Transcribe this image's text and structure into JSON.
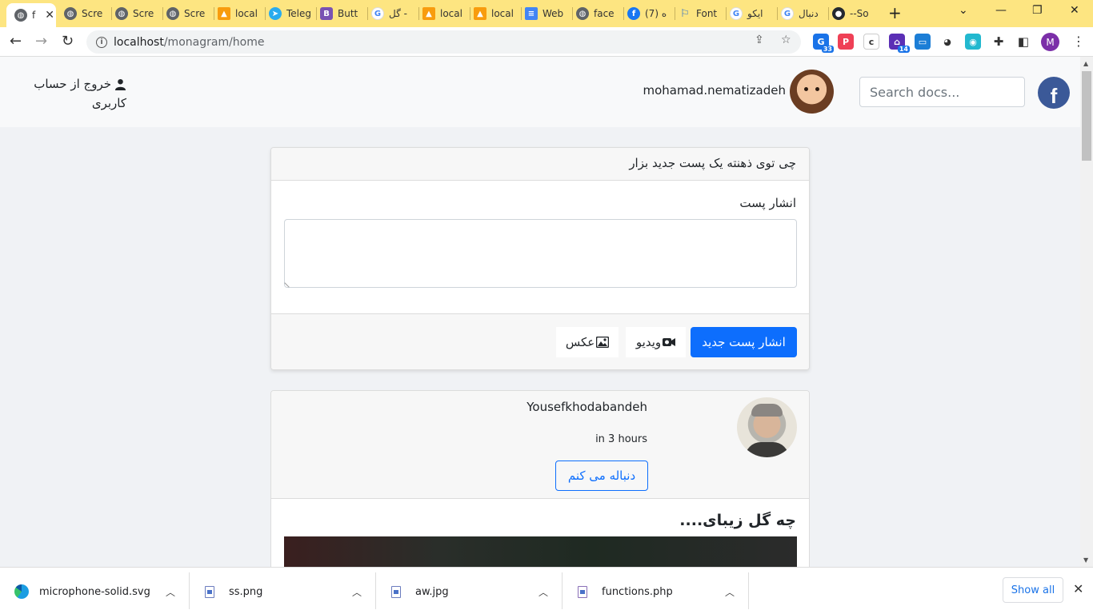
{
  "browser": {
    "tabs": [
      {
        "title": "f",
        "icon": "globe-icon",
        "active": true
      },
      {
        "title": "Scre",
        "icon": "globe-icon"
      },
      {
        "title": "Scre",
        "icon": "globe-icon"
      },
      {
        "title": "Scre",
        "icon": "globe-icon"
      },
      {
        "title": "local",
        "icon": "phpmyadmin-icon"
      },
      {
        "title": "Teleg",
        "icon": "telegram-icon"
      },
      {
        "title": "Butt",
        "icon": "bootstrap-icon"
      },
      {
        "title": "گل -",
        "icon": "google-icon"
      },
      {
        "title": "local",
        "icon": "phpmyadmin-icon"
      },
      {
        "title": "local",
        "icon": "phpmyadmin-icon"
      },
      {
        "title": "Web",
        "icon": "docs-icon"
      },
      {
        "title": "face",
        "icon": "globe-icon"
      },
      {
        "title": "(7) ه",
        "icon": "facebook-icon"
      },
      {
        "title": "Font",
        "icon": "flag-icon"
      },
      {
        "title": "ایکو",
        "icon": "google-icon"
      },
      {
        "title": "دنبال",
        "icon": "google-icon"
      },
      {
        "title": "--So",
        "icon": "github-icon"
      }
    ],
    "new_tab": "+",
    "url_host": "localhost",
    "url_path": "/monagram/home",
    "extensions": [
      {
        "icon": "translate-icon",
        "badge": "33",
        "color": "#1a73e8"
      },
      {
        "icon": "pocket-icon",
        "badge": "",
        "color": "#ef4056"
      },
      {
        "icon": "c-icon",
        "badge": "",
        "color": "#ffffff"
      },
      {
        "icon": "school-icon",
        "badge": "14",
        "color": "#5b2fb5"
      },
      {
        "icon": "screen-icon",
        "badge": "",
        "color": "#1c7ed6"
      },
      {
        "icon": "cat-icon",
        "badge": "",
        "color": "#ffffff"
      },
      {
        "icon": "camera-icon",
        "badge": "",
        "color": "#22b8cf"
      }
    ],
    "profile_initial": "M"
  },
  "navbar": {
    "search_placeholder": "Search docs...",
    "username": "mohamad.nematizadeh",
    "logout_line1": "خروج از حساب",
    "logout_line2": "کاربری",
    "brand_letter": "f"
  },
  "composer": {
    "header": "چی توی ذهنته یک پست جدید بزار",
    "label": "انشار پست",
    "publish_button": "انشار پست جدید",
    "video_button": "ویدیو",
    "photo_button": "عکس"
  },
  "post": {
    "author": "Yousefkhodabandeh",
    "time": "in 3 hours",
    "follow_button": "دنباله می کنم",
    "title": "چه گل زیبای...."
  },
  "downloads": {
    "items": [
      {
        "name": "microphone-solid.svg",
        "icon": "edge-icon"
      },
      {
        "name": "ss.png",
        "icon": "image-file-icon"
      },
      {
        "name": "aw.jpg",
        "icon": "image-file-icon"
      },
      {
        "name": "functions.php",
        "icon": "php-file-icon"
      }
    ],
    "show_all": "Show all"
  },
  "colors": {
    "tabstrip": "#fde581",
    "primary": "#0d6efd",
    "facebook": "#3b5998"
  }
}
